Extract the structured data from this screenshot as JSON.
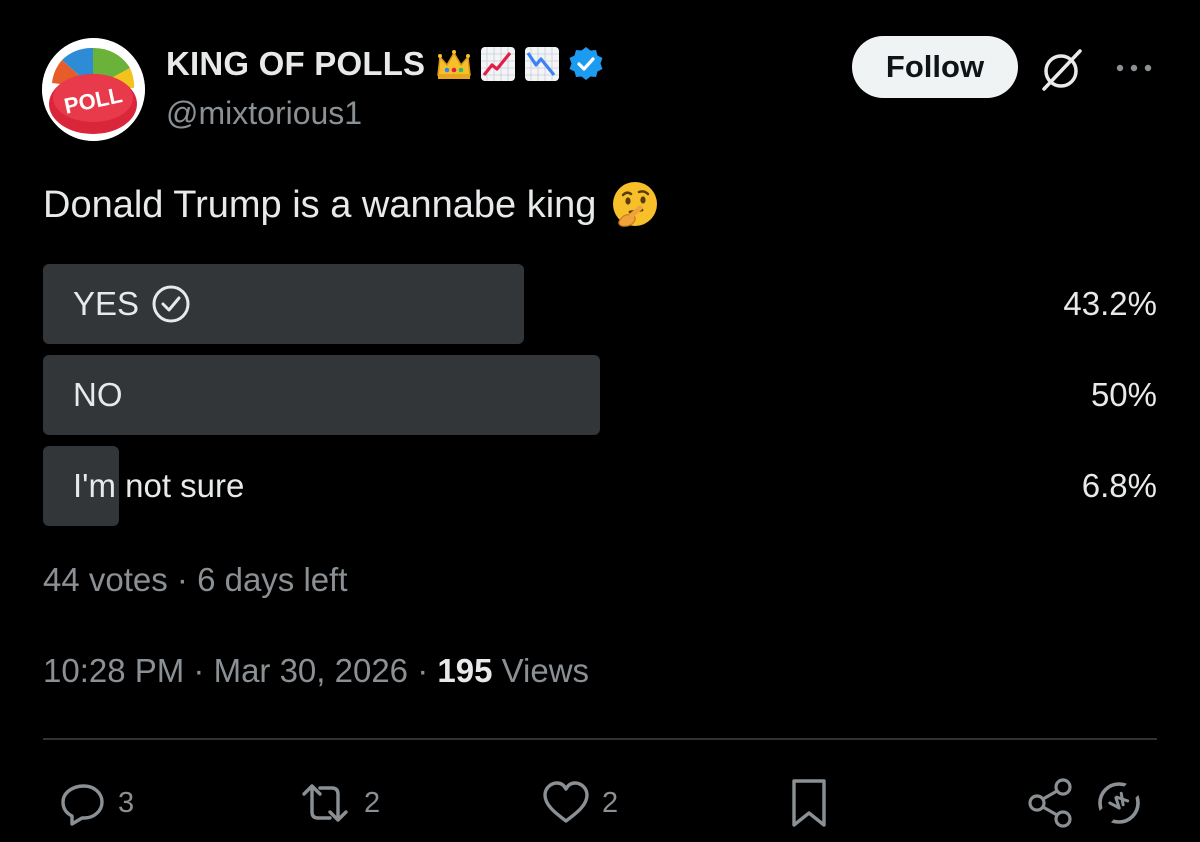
{
  "author": {
    "display_name": "KING OF POLLS",
    "handle": "@mixtorious1",
    "avatar_text": "POLL",
    "badges": [
      "crown-emoji",
      "chart-increasing-emoji",
      "chart-decreasing-emoji",
      "verified-badge"
    ]
  },
  "header": {
    "follow_label": "Follow"
  },
  "tweet": {
    "text": "Donald Trump is a wannabe king",
    "emoji": "thinking-face-emoji"
  },
  "poll": {
    "options": [
      {
        "label": "YES",
        "percent_text": "43.2%",
        "percent": 43.2,
        "voted": true
      },
      {
        "label": "NO",
        "percent_text": "50%",
        "percent": 50,
        "voted": false
      },
      {
        "label": "I'm not sure",
        "percent_text": "6.8%",
        "percent": 6.8,
        "voted": false
      }
    ],
    "votes": "44 votes",
    "time_left": "6 days left",
    "separator": " · "
  },
  "meta": {
    "time": "10:28 PM",
    "date": "Mar 30, 2026",
    "views_count": "195",
    "views_label": "Views",
    "separator": " · "
  },
  "actions": {
    "replies": "3",
    "reposts": "2",
    "likes": "2"
  },
  "colors": {
    "background": "#000000",
    "text": "#e7e9ea",
    "muted": "#8b9095",
    "poll_bar": "#333639",
    "verified": "#1d9bf0",
    "follow_bg": "#eff3f4"
  }
}
